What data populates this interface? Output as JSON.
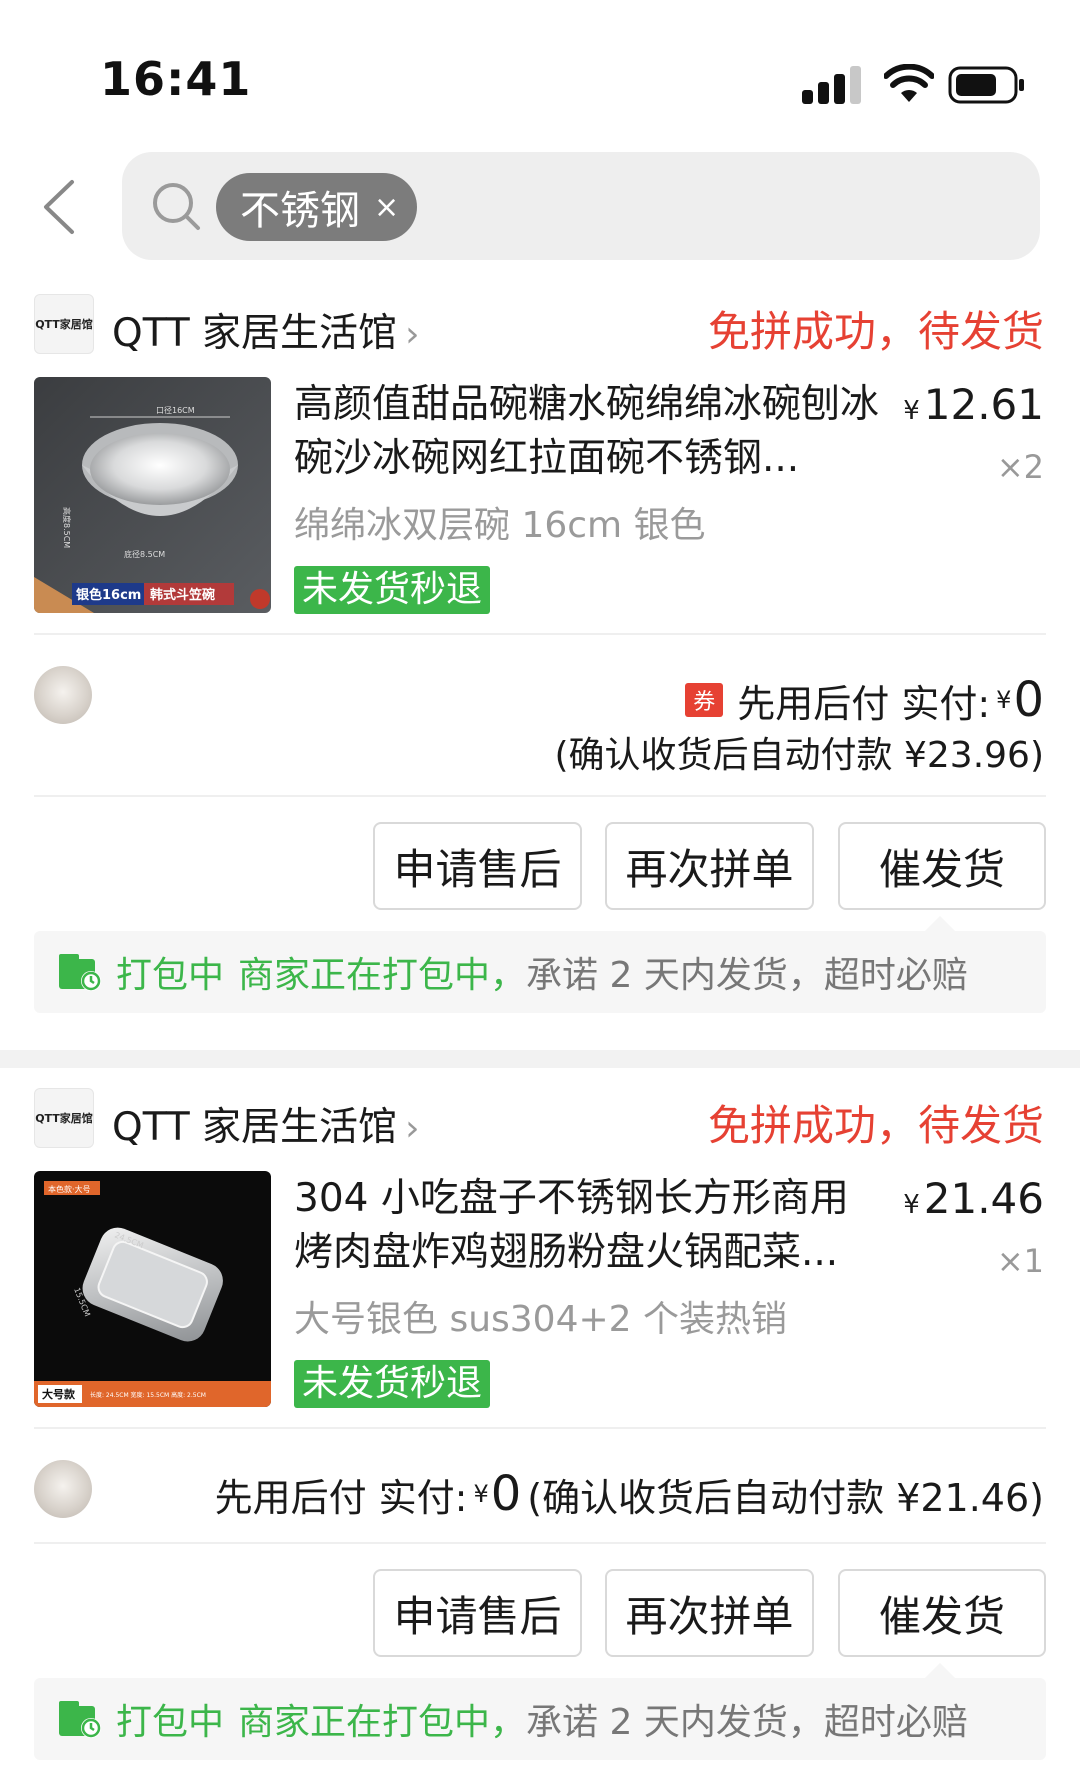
{
  "status_bar": {
    "time": "16:41"
  },
  "search": {
    "chip_label": "不锈钢",
    "chip_clear": "×"
  },
  "orders": [
    {
      "shop_logo_text": "QTT家居馆",
      "shop_name": "QTT 家居生活馆",
      "status": "免拼成功，待发货",
      "product": {
        "title": "高颜值甜品碗糖水碗绵绵冰碗刨冰碗沙冰碗网红拉面碗不锈钢...",
        "price_symbol": "¥",
        "price": "12.61",
        "quantity": "×2",
        "spec": "绵绵冰双层碗 16cm 银色",
        "badge": "未发货秒退",
        "image_text": {
          "top": "口径16CM",
          "side": "高度8.5CM",
          "bottom": "底径8.5CM",
          "tag1": "银色16cm",
          "tag2": "韩式斗笠碗"
        }
      },
      "coupon_label": "券",
      "pay_prefix": "先用后付 实付:",
      "pay_symbol": "¥",
      "pay_amount": "0",
      "pay_note": "(确认收货后自动付款 ¥23.96)",
      "buttons": [
        "申请售后",
        "再次拼单",
        "催发货"
      ],
      "notice_status": "打包中",
      "notice_green": "商家正在打包中，",
      "notice_gray": "承诺 2 天内发货，超时必赔"
    },
    {
      "shop_logo_text": "QTT家居馆",
      "shop_name": "QTT 家居生活馆",
      "status": "免拼成功，待发货",
      "product": {
        "title": "304 小吃盘子不锈钢长方形商用烤肉盘炸鸡翅肠粉盘火锅配菜...",
        "price_symbol": "¥",
        "price": "21.46",
        "quantity": "×1",
        "spec": "大号银色 sus304+2 个装热销",
        "badge": "未发货秒退",
        "image_text": {
          "top_tag": "本色款·大号",
          "width": "24.5CM",
          "depth": "15.5CM",
          "tag": "大号款",
          "dims": "长度: 24.5CM  宽度: 15.5CM  高度: 2.5CM"
        }
      },
      "pay_prefix": "先用后付 实付:",
      "pay_symbol": "¥",
      "pay_amount": "0",
      "pay_note": "(确认收货后自动付款 ¥21.46)",
      "buttons": [
        "申请售后",
        "再次拼单",
        "催发货"
      ],
      "notice_status": "打包中",
      "notice_green": "商家正在打包中，",
      "notice_gray": "承诺 2 天内发货，超时必赔"
    }
  ],
  "colors": {
    "accent_red": "#e64133",
    "green": "#3cb64a",
    "muted": "#999999"
  }
}
